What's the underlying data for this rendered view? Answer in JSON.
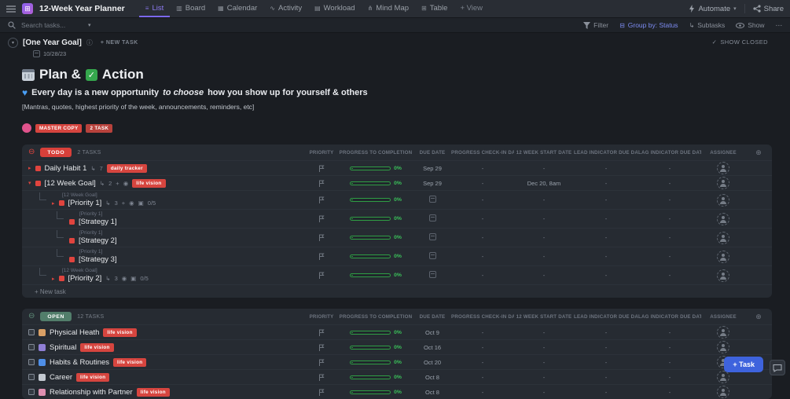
{
  "topbar": {
    "title": "12-Week Year Planner",
    "tabs": [
      {
        "label": "List"
      },
      {
        "label": "Board"
      },
      {
        "label": "Calendar"
      },
      {
        "label": "Activity"
      },
      {
        "label": "Workload"
      },
      {
        "label": "Mind Map"
      },
      {
        "label": "Table"
      }
    ],
    "add_view": "+ View",
    "automate": "Automate",
    "share": "Share"
  },
  "toolbar": {
    "search_placeholder": "Search tasks...",
    "filter": "Filter",
    "group_by": "Group by: Status",
    "subtasks": "Subtasks",
    "show": "Show",
    "more": "⋯",
    "show_closed": "SHOW CLOSED"
  },
  "doc": {
    "goal": "[One Year Goal]",
    "new_task": "+ NEW TASK",
    "date": "10/28/23",
    "heading_icon_1": "calendar-emoji",
    "heading_1": "Plan &",
    "heading_icon_2": "check-mark-emoji",
    "heading_2": "Action",
    "subtitle_icon": "blue-heart-emoji",
    "subtitle_1": "Every day is a new opportunity",
    "subtitle_em": "to choose",
    "subtitle_2": "how you show up for yourself & others",
    "note": "[Mantras, quotes, highest priority of the week, announcements, reminders, etc]",
    "chip_master": "MASTER COPY",
    "chip_count": "2 TASK"
  },
  "columns": [
    "PRIORITY",
    "PROGRESS TO COMPLETION",
    "DUE DATE",
    "PROGRESS CHECK-IN DATE",
    "12 WEEK START DATE",
    "LEAD INDICATOR DUE DATE",
    "LAG INDICATOR DUE DATE",
    "ASSIGNEE"
  ],
  "dash": "-",
  "progress_zero": "0%",
  "groups": {
    "todo": {
      "status": "TODO",
      "count": "2 TASKS"
    },
    "open": {
      "status": "OPEN",
      "count": "12 TASKS"
    }
  },
  "todo_rows": [
    {
      "name": "Daily Habit 1",
      "subtasks": "7",
      "tag": "daily tracker",
      "due": "Sep 29"
    },
    {
      "name": "[12 Week Goal]",
      "subtasks": "2",
      "plus": "+",
      "tag": "life vision",
      "due": "Sep 29",
      "start": "Dec 20, 8am"
    },
    {
      "parent": "[12 Week Goal]",
      "name": "[Priority 1]",
      "subtasks": "3",
      "plus": "+",
      "checklist": "0/5"
    },
    {
      "parent": "[Priority 1]",
      "name": "[Strategy 1]"
    },
    {
      "parent": "[Priority 1]",
      "name": "[Strategy 2]"
    },
    {
      "parent": "[Priority 1]",
      "name": "[Strategy 3]"
    },
    {
      "parent": "[12 Week Goal]",
      "name": "[Priority 2]",
      "subtasks": "3",
      "checklist": "0/5"
    }
  ],
  "new_task_label": "+ New task",
  "open_rows": [
    {
      "icon": "muscle-emoji",
      "name": "Physical Heath",
      "tag": "life vision",
      "due": "Oct 9"
    },
    {
      "icon": "pray-emoji",
      "name": "Spiritual",
      "tag": "life vision",
      "due": "Oct 16"
    },
    {
      "icon": "repeat-emoji",
      "name": "Habits & Routines",
      "tag": "life vision",
      "due": "Oct 20"
    },
    {
      "icon": "chart-emoji",
      "name": "Career",
      "tag": "life vision",
      "due": "Oct 8"
    },
    {
      "icon": "couple-emoji",
      "name": "Relationship with Partner",
      "tag": "life vision",
      "due": "Oct 8"
    }
  ],
  "footer": {
    "task_button": "+ Task"
  },
  "colors": {
    "accent_purple": "#7b68ee",
    "status_todo_red": "#d8403a",
    "status_open_green": "#527e6b",
    "tag_red": "#d6453f",
    "progress_green": "#2f9e44",
    "task_button_blue": "#3e63dd"
  }
}
